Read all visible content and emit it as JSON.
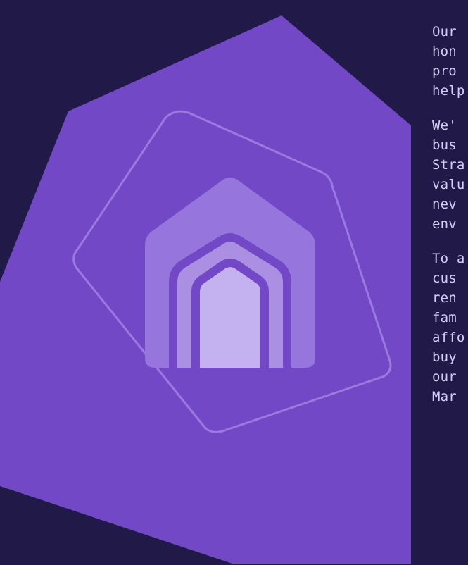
{
  "colors": {
    "background": "#211a48",
    "pentagon": "#7248c6",
    "inner_outline": "#9a7ae0",
    "house_outer": "#9676dc",
    "house_middle": "#aa8fe3",
    "house_inner": "#c4b1ef",
    "house_stroke": "#7248c6",
    "text": "#d6cdf5"
  },
  "icon": {
    "name": "house-icon"
  },
  "paragraphs": [
    {
      "lines": [
        "Our",
        "hon",
        "pro",
        "help"
      ]
    },
    {
      "lines": [
        "We'",
        "bus",
        "Stra",
        "valu",
        "nev",
        "env"
      ]
    },
    {
      "lines": [
        "To a",
        "cus",
        "ren",
        "fam",
        "affo",
        "buy",
        "our",
        "Mar"
      ]
    }
  ]
}
